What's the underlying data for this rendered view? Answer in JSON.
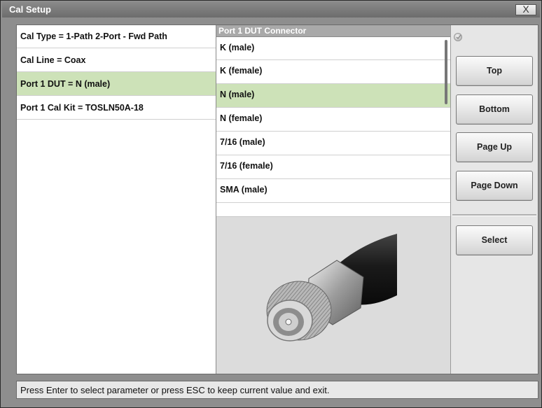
{
  "window": {
    "title": "Cal Setup",
    "close_label": "X"
  },
  "params": [
    {
      "label": "Cal Type = 1-Path 2-Port - Fwd Path",
      "selected": false
    },
    {
      "label": "Cal Line = Coax",
      "selected": false
    },
    {
      "label": "Port 1 DUT = N (male)",
      "selected": true
    },
    {
      "label": "Port 1 Cal Kit = TOSLN50A-18",
      "selected": false
    }
  ],
  "connector_list": {
    "header": "Port 1 DUT Connector",
    "items": [
      {
        "label": "K (male)",
        "selected": false
      },
      {
        "label": "K (female)",
        "selected": false
      },
      {
        "label": "N (male)",
        "selected": true
      },
      {
        "label": "N (female)",
        "selected": false
      },
      {
        "label": "7/16 (male)",
        "selected": false
      },
      {
        "label": "7/16 (female)",
        "selected": false
      },
      {
        "label": "SMA (male)",
        "selected": false
      }
    ]
  },
  "preview": {
    "icon": "n-male-connector-image"
  },
  "buttons": {
    "top": "Top",
    "bottom": "Bottom",
    "page_up": "Page Up",
    "page_down": "Page Down",
    "select": "Select"
  },
  "status": "Press Enter to select parameter or press ESC to keep current value and exit.",
  "colors": {
    "selected_row": "#cde2b8",
    "title_bar": "#7c7c7c"
  }
}
